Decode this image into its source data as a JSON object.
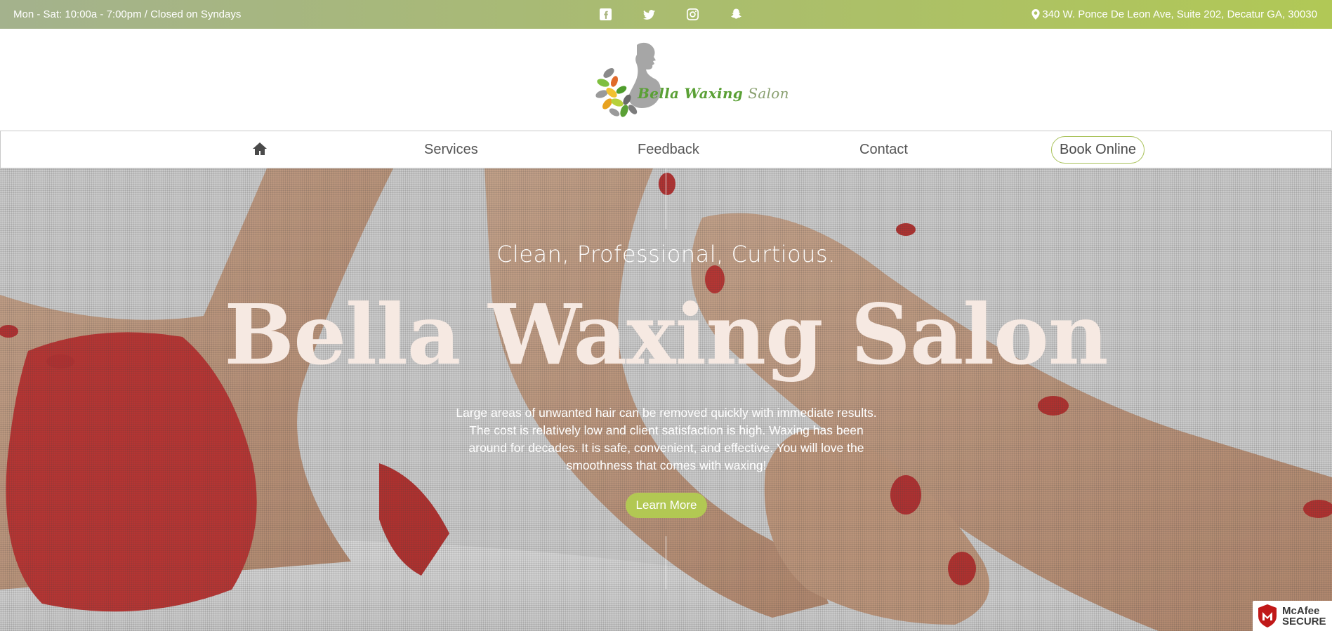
{
  "topbar": {
    "hours": "Mon - Sat: 10:00a - 7:00pm / Closed on Syndays",
    "address": "340 W. Ponce De Leon Ave, Suite 202, Decatur GA, 30030",
    "socials": [
      "facebook-icon",
      "twitter-icon",
      "instagram-icon",
      "snapchat-icon"
    ]
  },
  "logo": {
    "brand": "Bella Waxing",
    "suffix": "Salon"
  },
  "nav": {
    "home_icon": "home-icon",
    "items": [
      {
        "label": "Services"
      },
      {
        "label": "Feedback"
      },
      {
        "label": "Contact"
      }
    ],
    "book_label": "Book Online"
  },
  "hero": {
    "tagline": "Clean, Professional, Curtious.",
    "title": "Bella Waxing Salon",
    "description": "Large areas of unwanted hair can be removed quickly with immediate results. The cost is relatively low and client satisfaction is high. Waxing has been around for decades. It is safe, convenient, and effective. You will love the smoothness that comes with waxing!",
    "button_label": "Learn More"
  },
  "badge": {
    "line1": "McAfee",
    "line2": "SECURE"
  },
  "colors": {
    "accent": "#b2c853",
    "topbar_start": "#a4b28d",
    "topbar_end": "#b1c856",
    "hero_title": "#f6e9e2"
  }
}
